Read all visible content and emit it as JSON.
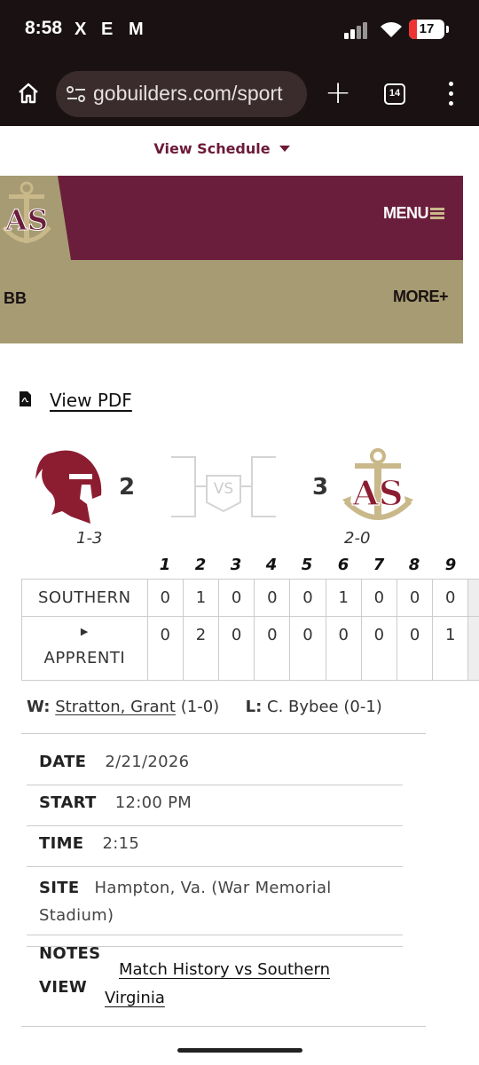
{
  "status_bar": {
    "time": "8:58",
    "app_icons": [
      "X",
      "E",
      "M"
    ],
    "battery": "17"
  },
  "browser": {
    "url": "gobuilders.com/sport",
    "tab_count": "14"
  },
  "page": {
    "view_schedule": "View Schedule",
    "menu_label": "MENU",
    "nav_partial": "BB",
    "more_label": "MORE+",
    "view_pdf": "View PDF",
    "colors": {
      "maroon": "#6b1e3c",
      "gold": "#a69b72"
    }
  },
  "game": {
    "away": {
      "name": "SOUTHERN",
      "score": "2",
      "record": "1-3",
      "logo": "spartan-helmet-icon"
    },
    "home": {
      "name": "APPRENTI",
      "score": "3",
      "record": "2-0",
      "logo": "anchor-as-logo"
    },
    "vs_label": "VS",
    "innings": [
      "1",
      "2",
      "3",
      "4",
      "5",
      "6",
      "7",
      "8",
      "9"
    ],
    "away_line": [
      "0",
      "1",
      "0",
      "0",
      "0",
      "1",
      "0",
      "0",
      "0"
    ],
    "home_line": [
      "0",
      "2",
      "0",
      "0",
      "0",
      "0",
      "0",
      "0",
      "1"
    ],
    "winning_pitcher_label": "W:",
    "winning_pitcher": "Stratton, Grant",
    "winning_record": "(1-0)",
    "losing_pitcher_label": "L:",
    "losing_pitcher": "C. Bybee (0-1)"
  },
  "details": {
    "date_label": "DATE",
    "date": "2/21/2026",
    "start_label": "START",
    "start": "12:00 PM",
    "time_label": "TIME",
    "time": "2:15",
    "site_label": "SITE",
    "site": "Hampton, Va. (War Memorial Stadium)",
    "notes_label": "NOTES",
    "view_label": "VIEW",
    "history_link": "Match History vs Southern Virginia"
  }
}
